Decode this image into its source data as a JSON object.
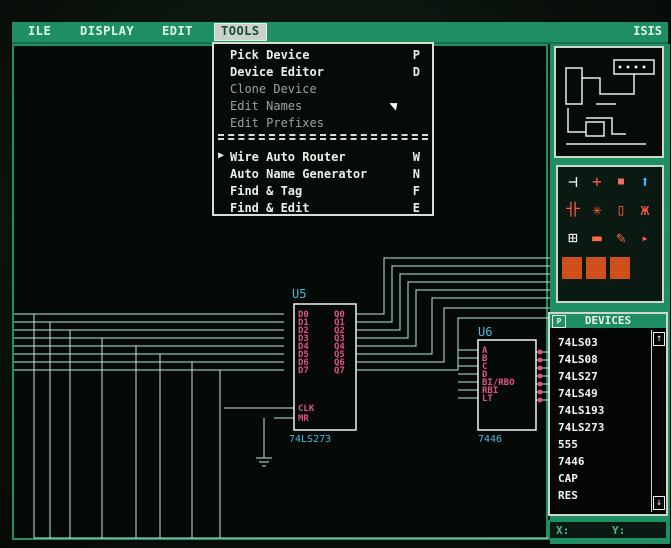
{
  "menubar": {
    "items": [
      "ILE",
      "DISPLAY",
      "EDIT",
      "TOOLS"
    ],
    "title": "ISIS"
  },
  "tools_menu": {
    "items": [
      {
        "label": "Pick Device",
        "key": "P",
        "enabled": true
      },
      {
        "label": "Device Editor",
        "key": "D",
        "enabled": true
      },
      {
        "label": "Clone Device",
        "key": "",
        "enabled": false
      },
      {
        "label": "Edit Names",
        "key": "",
        "enabled": false
      },
      {
        "label": "Edit Prefixes",
        "key": "",
        "enabled": false
      },
      {
        "label": "Wire Auto Router",
        "key": "W",
        "enabled": true
      },
      {
        "label": "Auto Name Generator",
        "key": "N",
        "enabled": true
      },
      {
        "label": "Find & Tag",
        "key": "F",
        "enabled": true
      },
      {
        "label": "Find & Edit",
        "key": "E",
        "enabled": true
      }
    ]
  },
  "schematic": {
    "u5": {
      "ref": "U5",
      "part": "74LS273",
      "left_pins": [
        "D0",
        "D1",
        "D2",
        "D3",
        "D4",
        "D5",
        "D6",
        "D7"
      ],
      "right_pins": [
        "Q0",
        "Q1",
        "Q2",
        "Q3",
        "Q4",
        "Q5",
        "Q6",
        "Q7"
      ],
      "ctrl_pins": [
        "CLK",
        "MR"
      ]
    },
    "u6": {
      "ref": "U6",
      "part": "7446",
      "left_pins": [
        "A",
        "B",
        "C",
        "D",
        "BI/RBO",
        "RBI",
        "LT"
      ]
    }
  },
  "devices_panel": {
    "header": "DEVICES",
    "icon": "P",
    "items": [
      "74LS03",
      "74LS08",
      "74LS27",
      "74LS49",
      "74LS193",
      "74LS273",
      "555",
      "7446",
      "CAP",
      "RES"
    ]
  },
  "status": {
    "x_label": "X:",
    "y_label": "Y:"
  },
  "colors": {
    "accent": "#1f8f63",
    "wire": "#bfe6dc",
    "pin": "#e0518c",
    "component": "#f2f2f2"
  }
}
